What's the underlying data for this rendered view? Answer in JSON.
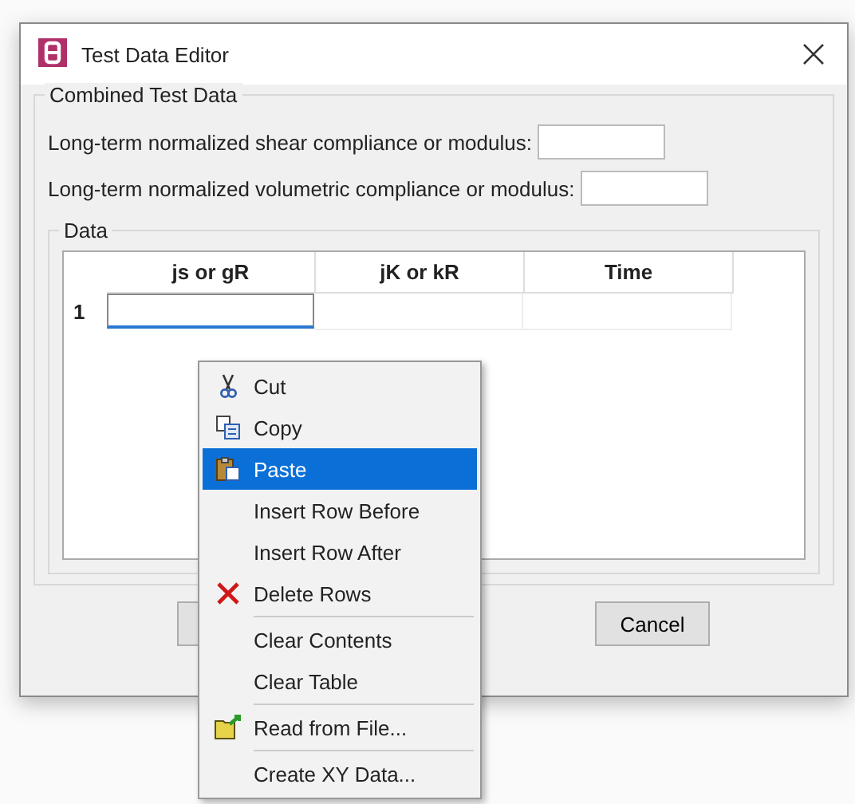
{
  "window": {
    "title": "Test Data Editor"
  },
  "group": {
    "title": "Combined Test Data"
  },
  "fields": [
    {
      "label": "Long-term normalized shear compliance or modulus:"
    },
    {
      "label": "Long-term normalized volumetric compliance or modulus:"
    }
  ],
  "data": {
    "title": "Data",
    "columns": [
      "js or gR",
      "jK or kR",
      "Time"
    ],
    "rows": [
      {
        "number": "1",
        "editing": true
      }
    ]
  },
  "buttons": [
    {
      "kind": "covered"
    },
    {
      "label": "Cancel",
      "kind": "labeled"
    }
  ],
  "context_menu": [
    {
      "kind": "cut",
      "label": "Cut",
      "selected": false
    },
    {
      "kind": "copy",
      "label": "Copy",
      "selected": false
    },
    {
      "kind": "paste",
      "label": "Paste",
      "selected": true
    },
    {
      "kind": "plain",
      "label": "Insert Row Before",
      "selected": false
    },
    {
      "kind": "plain",
      "label": "Insert Row After",
      "selected": false
    },
    {
      "kind": "delete",
      "label": "Delete Rows",
      "selected": false
    },
    {
      "kind": "separator"
    },
    {
      "kind": "plain",
      "label": "Clear Contents",
      "selected": false
    },
    {
      "kind": "plain",
      "label": "Clear Table",
      "selected": false
    },
    {
      "kind": "separator"
    },
    {
      "kind": "open-file",
      "label": "Read from File...",
      "selected": false
    },
    {
      "kind": "separator"
    },
    {
      "kind": "plain",
      "label": "Create XY Data...",
      "selected": false
    }
  ]
}
